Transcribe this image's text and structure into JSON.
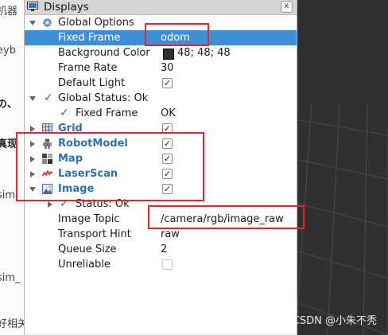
{
  "background_page": {
    "snippets": [
      "机器",
      "eyb",
      "の、",
      "真现",
      "sim",
      "sim_",
      "好相关"
    ]
  },
  "panel": {
    "title": "Displays",
    "close_label": "x"
  },
  "tree": {
    "global_options": {
      "label": "Global Options",
      "fixed_frame_label": "Fixed Frame",
      "fixed_frame_value": "odom",
      "background_color_label": "Background Color",
      "background_color_value": "48; 48; 48",
      "background_color_hex": "#303030",
      "frame_rate_label": "Frame Rate",
      "frame_rate_value": "30",
      "default_light_label": "Default Light",
      "default_light_checked": true
    },
    "global_status": {
      "label": "Global Status: Ok",
      "fixed_frame_label": "Fixed Frame",
      "fixed_frame_value": "OK"
    },
    "displays": [
      {
        "label": "Grid",
        "icon": "grid-icon",
        "checked": true
      },
      {
        "label": "RobotModel",
        "icon": "robot-icon",
        "checked": true
      },
      {
        "label": "Map",
        "icon": "map-icon",
        "checked": true
      },
      {
        "label": "LaserScan",
        "icon": "laserscan-icon",
        "checked": true
      },
      {
        "label": "Image",
        "icon": "image-icon",
        "checked": true
      }
    ],
    "image": {
      "status_label": "Status: Ok",
      "image_topic_label": "Image Topic",
      "image_topic_value": "/camera/rgb/image_raw",
      "transport_hint_label": "Transport Hint",
      "transport_hint_value": "raw",
      "queue_size_label": "Queue Size",
      "queue_size_value": "2",
      "unreliable_label": "Unreliable",
      "unreliable_checked": false
    }
  },
  "check_mark": "✓",
  "watermark": "CSDN @小朱不秃",
  "colors": {
    "selection": "#3e8ed6",
    "display_label": "#2c6fb5",
    "annotation": "#e4232b",
    "viewport": "#303030"
  }
}
